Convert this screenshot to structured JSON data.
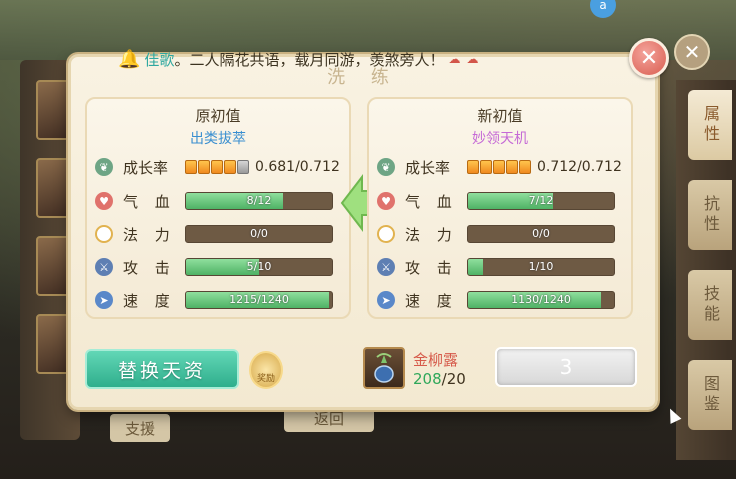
{
  "announcement": {
    "name": "佳歌",
    "message": "。二人隔花共语，载月同游，羡煞旁人！"
  },
  "dialog": {
    "title": "洗 练",
    "close_icon": "close-icon"
  },
  "original": {
    "heading": "原初值",
    "subtitle": "出类拔萃",
    "growth_label": "成长率",
    "growth_stars_filled": 4,
    "growth_stars_total": 5,
    "growth_value": "0.681/0.712",
    "stats": [
      {
        "icon": "heart-icon",
        "label": "气 血",
        "text": "8/12",
        "fraction": 0.667
      },
      {
        "icon": "mana-icon",
        "label": "法 力",
        "text": "0/0",
        "fraction": 0
      },
      {
        "icon": "sword-icon",
        "label": "攻 击",
        "text": "5/10",
        "fraction": 0.5
      },
      {
        "icon": "speed-icon",
        "label": "速 度",
        "text": "1215/1240",
        "fraction": 0.98
      }
    ]
  },
  "new": {
    "heading": "新初值",
    "subtitle": "妙领天机",
    "growth_label": "成长率",
    "growth_stars_filled": 5,
    "growth_stars_total": 5,
    "growth_value": "0.712/0.712",
    "stats": [
      {
        "icon": "heart-icon",
        "label": "气 血",
        "text": "7/12",
        "fraction": 0.583
      },
      {
        "icon": "mana-icon",
        "label": "法 力",
        "text": "0/0",
        "fraction": 0
      },
      {
        "icon": "sword-icon",
        "label": "攻 击",
        "text": "1/10",
        "fraction": 0.1
      },
      {
        "icon": "speed-icon",
        "label": "速 度",
        "text": "1130/1240",
        "fraction": 0.911
      }
    ]
  },
  "actions": {
    "replace_label": "替换天资",
    "badge_label": "奖励",
    "item_name": "金柳露",
    "item_have": "208",
    "item_need": "/20",
    "quantity": "3"
  },
  "background": {
    "tabs": [
      "属性",
      "抗性",
      "技能",
      "图鉴"
    ],
    "support_label": "支援",
    "return_label": "返回"
  },
  "colors": {
    "accent_green": "#2fae8c",
    "bar_fill": "#4fb265",
    "close_red": "#d95d50"
  }
}
